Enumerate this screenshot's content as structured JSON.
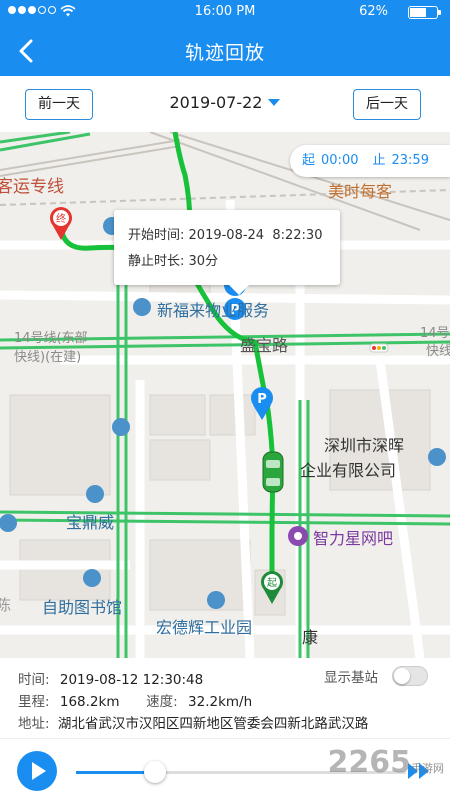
{
  "status_bar": {
    "time": "16:00 PM",
    "battery": "62%",
    "battery_level": 0.62
  },
  "nav": {
    "title": "轨迹回放"
  },
  "date_bar": {
    "prev_label": "前一天",
    "date": "2019-07-22",
    "next_label": "后一天"
  },
  "time_range": {
    "start_label": "起",
    "start": "00:00",
    "end_label": "止",
    "end": "23:59"
  },
  "popup": {
    "start_label": "开始时间:",
    "start_value": "2019-08-24  8:22:30",
    "duration_label": "静止时长:",
    "duration_value": "30分"
  },
  "map": {
    "labels": {
      "freight_line": "客运专线",
      "meishi": "美时每客",
      "xinfu": "新福来物业服务",
      "line14_left_1": "14号线(东部",
      "line14_left_2": "快线)(在建)",
      "line14_right_1": "14号",
      "line14_right_2": "快线",
      "yingbao_road": "盛宝路",
      "shenzhen_company_1": "深圳市深晖",
      "shenzhen_company_2": "企业有限公司",
      "baodingwei": "宝鼎威",
      "zhilixing": "智力星网吧",
      "library": "自助图书馆",
      "industrial_park": "宏德辉工业园",
      "kang": "康",
      "chen": "陈"
    },
    "markers": {
      "end_marker": "终",
      "start_marker": "起",
      "parking": "P"
    }
  },
  "info": {
    "time_label": "时间:",
    "time_value": "2019-08-12 12:30:48",
    "mileage_label": "里程:",
    "mileage_value": "168.2km",
    "speed_label": "速度:",
    "speed_value": "32.2km/h",
    "address_label": "地址:",
    "address_value": "湖北省武汉市汉阳区四新地区管委会四新北路武汉路",
    "show_station_label": "显示基站",
    "show_station_on": false
  },
  "player": {
    "progress": 0.24
  },
  "watermark": {
    "text": "2265",
    "sub": "手游网"
  },
  "colors": {
    "primary": "#1a8ef0",
    "route": "#17c13a",
    "road": "#3ec468",
    "end_marker": "#e5352f",
    "start_marker": "#1f8a3a",
    "poi_blue": "#4a92c9",
    "poi_red": "#c0503a",
    "purple": "#7a3aa0"
  }
}
